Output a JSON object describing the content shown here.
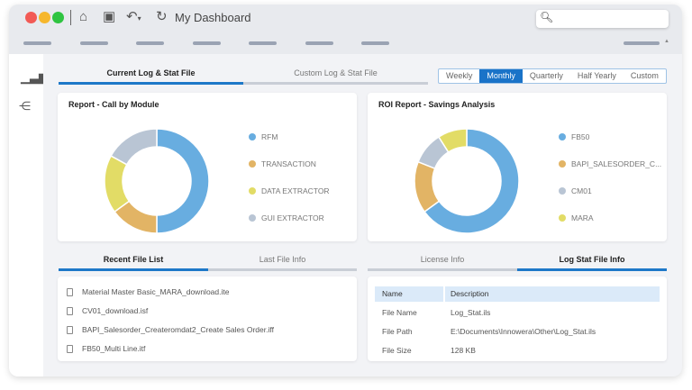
{
  "window": {
    "title": "My Dashboard",
    "traffic_colors": [
      "#f25a55",
      "#f6b72d",
      "#2fc441"
    ]
  },
  "toolbar": {
    "icons": [
      "home-icon",
      "save-icon",
      "undo-icon",
      "refresh-icon"
    ],
    "search_placeholder": ""
  },
  "top_tabs": [
    {
      "label": "Current Log & Stat File",
      "active": true
    },
    {
      "label": "Custom Log & Stat File",
      "active": false
    }
  ],
  "periods": [
    {
      "label": "Weekly"
    },
    {
      "label": "Monthly",
      "active": true
    },
    {
      "label": "Quarterly"
    },
    {
      "label": "Half Yearly"
    },
    {
      "label": "Custom"
    }
  ],
  "chart_data": [
    {
      "type": "pie",
      "title": "Report - Call by Module",
      "categories": [
        "RFM",
        "TRANSACTION",
        "DATA EXTRACTOR",
        "GUI EXTRACTOR"
      ],
      "values": [
        50,
        15,
        18,
        17
      ],
      "colors": [
        "#68ade0",
        "#e2b465",
        "#e2dc66",
        "#b9c5d4"
      ],
      "legend": "right"
    },
    {
      "type": "pie",
      "title": "ROI Report - Savings Analysis",
      "categories": [
        "FB50",
        "BAPI_SALESORDER_C...",
        "CM01",
        "MARA"
      ],
      "values": [
        65,
        16,
        10,
        9
      ],
      "colors": [
        "#68ade0",
        "#e2b465",
        "#b9c5d4",
        "#e2dc66"
      ],
      "legend": "right"
    }
  ],
  "left_tabs": [
    {
      "label": "Recent File List",
      "active": true
    },
    {
      "label": "Last File Info",
      "active": false
    }
  ],
  "files": [
    "Material Master Basic_MARA_download.ite",
    "CV01_download.isf",
    "BAPI_Salesorder_Createromdat2_Create Sales Order.iff",
    "FB50_Multi Line.itf"
  ],
  "right_tabs": [
    {
      "label": "License Info",
      "active": false
    },
    {
      "label": "Log Stat File Info",
      "active": true
    }
  ],
  "info_table": {
    "headers": [
      "Name",
      "Description"
    ],
    "rows": [
      [
        "File Name",
        "Log_Stat.ils"
      ],
      [
        "File Path",
        "E:\\Documents\\Innowera\\Other\\Log_Stat.ils"
      ],
      [
        "File Size",
        "128 KB"
      ]
    ]
  }
}
